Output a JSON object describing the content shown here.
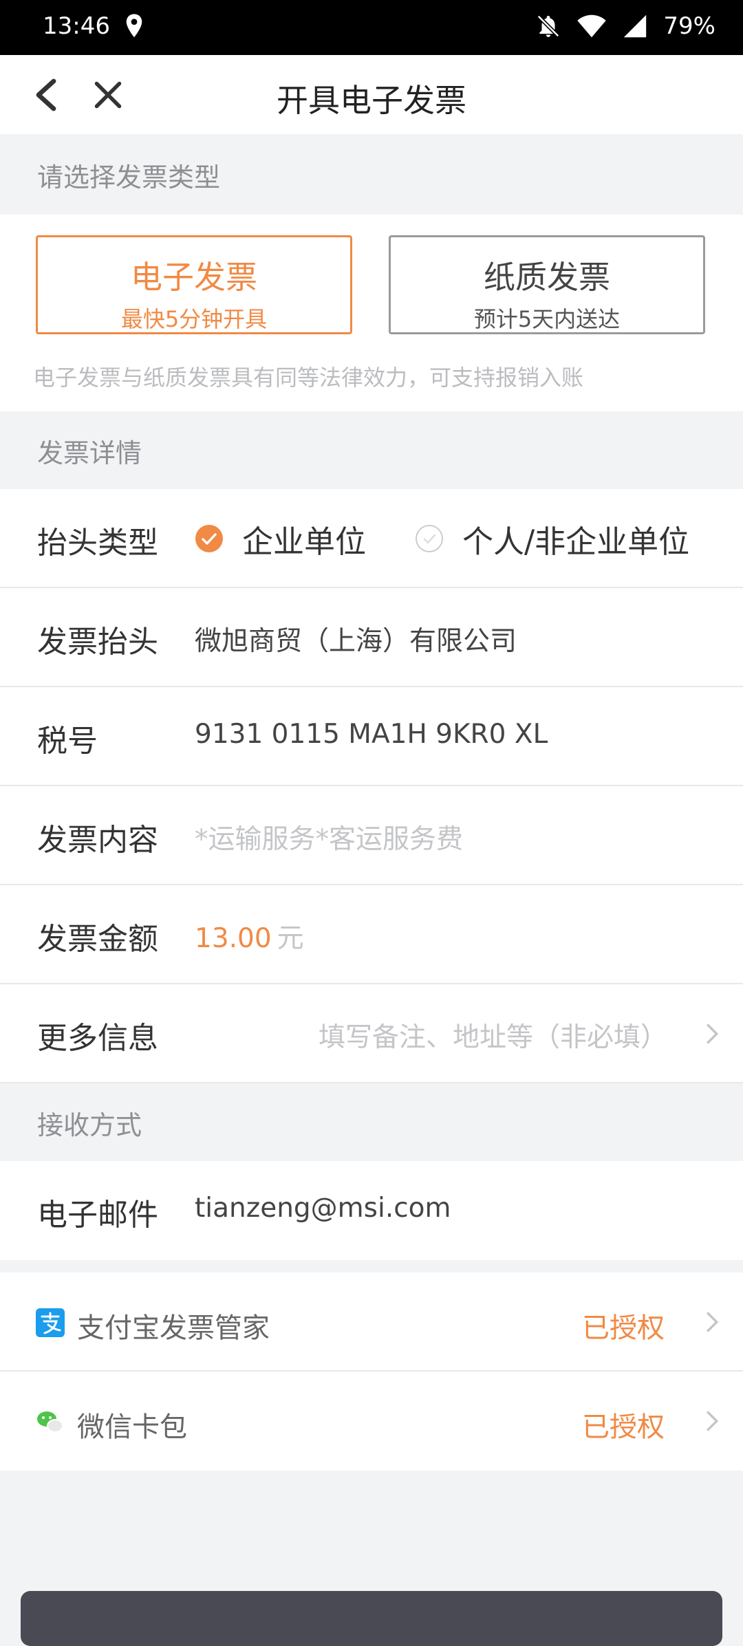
{
  "status_bar": {
    "time": "13:46",
    "battery": "79%",
    "icons": [
      "location-icon",
      "bell-off-icon",
      "wifi-icon",
      "cellular-signal-icon"
    ]
  },
  "header": {
    "title": "开具电子发票",
    "back_icon": "chevron-left-icon",
    "close_icon": "close-icon"
  },
  "invoice_type": {
    "section_title": "请选择发票类型",
    "options": [
      {
        "title": "电子发票",
        "subtitle": "最快5分钟开具",
        "selected": true
      },
      {
        "title": "纸质发票",
        "subtitle": "预计5天内送达",
        "selected": false
      }
    ],
    "hint": "电子发票与纸质发票具有同等法律效力，可支持报销入账"
  },
  "details": {
    "section_title": "发票详情",
    "header_type": {
      "label": "抬头类型",
      "options": [
        {
          "label": "企业单位",
          "selected": true
        },
        {
          "label": "个人/非企业单位",
          "selected": false
        }
      ]
    },
    "invoice_header": {
      "label": "发票抬头",
      "value": "微旭商贸（上海）有限公司"
    },
    "tax_number": {
      "label": "税号",
      "value": "9131 0115 MA1H 9KR0 XL"
    },
    "content": {
      "label": "发票内容",
      "value": "*运输服务*客运服务费"
    },
    "amount": {
      "label": "发票金额",
      "value": "13.00",
      "unit": "元"
    },
    "more_info": {
      "label": "更多信息",
      "placeholder": "填写备注、地址等（非必填）"
    }
  },
  "receive": {
    "section_title": "接收方式",
    "email": {
      "label": "电子邮件",
      "value": "tianzeng@msi.com"
    }
  },
  "authorizations": [
    {
      "name": "支付宝发票管家",
      "status": "已授权",
      "icon": "alipay-icon"
    },
    {
      "name": "微信卡包",
      "status": "已授权",
      "icon": "wechat-icon"
    }
  ],
  "colors": {
    "accent": "#f08a44",
    "background": "#f2f3f5",
    "alipay": "#1a9ded",
    "wechat": "#4fc34a"
  }
}
